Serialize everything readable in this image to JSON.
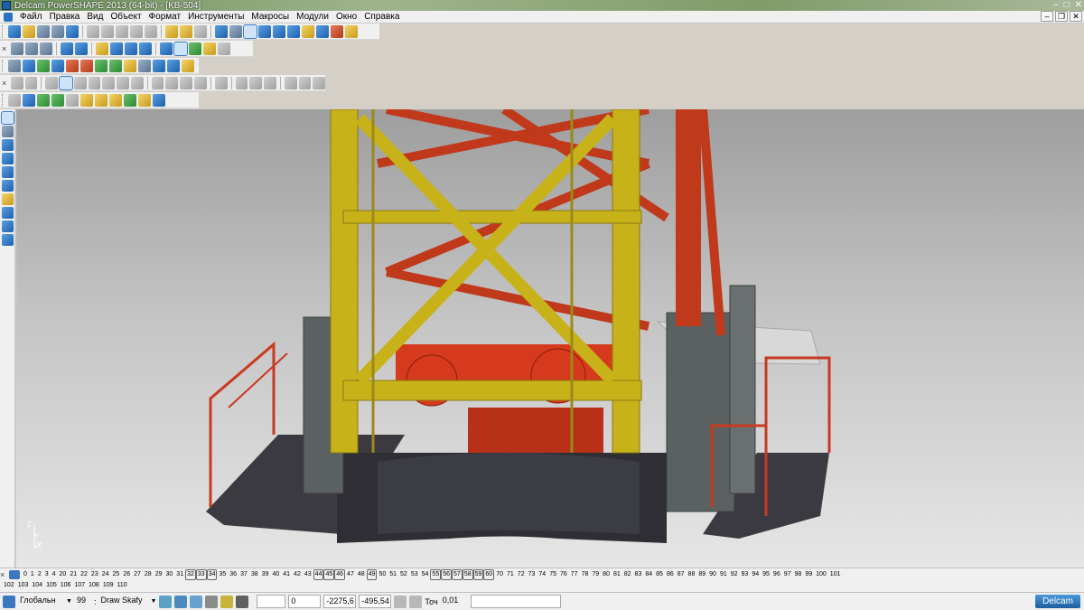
{
  "window": {
    "title": "Delcam PowerSHAPE 2013 (64-bit) - [KB-504]",
    "controls": [
      "–",
      "□",
      "✕"
    ]
  },
  "menu": {
    "items": [
      "Файл",
      "Правка",
      "Вид",
      "Объект",
      "Формат",
      "Инструменты",
      "Макросы",
      "Модули",
      "Окно",
      "Справка"
    ],
    "mdi_controls": [
      "–",
      "❐",
      "✕"
    ]
  },
  "viewport": {
    "axis": {
      "z": "Z",
      "y": "Y",
      "x": "X"
    },
    "colors": {
      "mast": "#c8b21a",
      "boom": "#c0391b",
      "motor": "#d63a1c",
      "platform": "#3a3a40",
      "cabinet": "#5b6060",
      "railing": "#c83a20"
    }
  },
  "levels": {
    "row1": [
      {
        "v": "0"
      },
      {
        "v": "1"
      },
      {
        "v": "2"
      },
      {
        "v": "3"
      },
      {
        "v": "4"
      },
      {
        "v": "20"
      },
      {
        "v": "21"
      },
      {
        "v": "22"
      },
      {
        "v": "23"
      },
      {
        "v": "24"
      },
      {
        "v": "25"
      },
      {
        "v": "26"
      },
      {
        "v": "27"
      },
      {
        "v": "28"
      },
      {
        "v": "29"
      },
      {
        "v": "30"
      },
      {
        "v": "31"
      },
      {
        "v": "32",
        "f": true
      },
      {
        "v": "33",
        "f": true
      },
      {
        "v": "34",
        "f": true
      },
      {
        "v": "35"
      },
      {
        "v": "36"
      },
      {
        "v": "37"
      },
      {
        "v": "38"
      },
      {
        "v": "39"
      },
      {
        "v": "40"
      },
      {
        "v": "41"
      },
      {
        "v": "42"
      },
      {
        "v": "43"
      },
      {
        "v": "44",
        "f": true
      },
      {
        "v": "45",
        "f": true
      },
      {
        "v": "46",
        "f": true
      },
      {
        "v": "47"
      },
      {
        "v": "48"
      },
      {
        "v": "49",
        "f": true
      },
      {
        "v": "50"
      },
      {
        "v": "51"
      },
      {
        "v": "52"
      },
      {
        "v": "53"
      },
      {
        "v": "54"
      },
      {
        "v": "55",
        "f": true
      },
      {
        "v": "56",
        "f": true
      },
      {
        "v": "57",
        "f": true
      },
      {
        "v": "58",
        "f": true
      },
      {
        "v": "59",
        "f": true
      },
      {
        "v": "60",
        "f": true
      },
      {
        "v": "70"
      },
      {
        "v": "71"
      },
      {
        "v": "72"
      },
      {
        "v": "73"
      },
      {
        "v": "74"
      },
      {
        "v": "75"
      },
      {
        "v": "76"
      },
      {
        "v": "77"
      },
      {
        "v": "78"
      },
      {
        "v": "79"
      },
      {
        "v": "80"
      },
      {
        "v": "81"
      },
      {
        "v": "82"
      },
      {
        "v": "83"
      },
      {
        "v": "84"
      },
      {
        "v": "85"
      },
      {
        "v": "86"
      },
      {
        "v": "87"
      },
      {
        "v": "88"
      },
      {
        "v": "89"
      },
      {
        "v": "90"
      },
      {
        "v": "91"
      },
      {
        "v": "92"
      },
      {
        "v": "93"
      },
      {
        "v": "94"
      },
      {
        "v": "95"
      },
      {
        "v": "96"
      },
      {
        "v": "97"
      },
      {
        "v": "98"
      },
      {
        "v": "99"
      },
      {
        "v": "100"
      },
      {
        "v": "101"
      }
    ],
    "row2": [
      "102",
      "103",
      "104",
      "105",
      "106",
      "107",
      "108",
      "109",
      "110"
    ]
  },
  "status": {
    "workplane": "Глобальн",
    "level_num": "99",
    "level_name": "Draw Skafy",
    "field0": "0",
    "x": "-2275,6",
    "y": "-495,54",
    "tolerance_label": "Точ",
    "tolerance": "0,01",
    "brand": "Delcam"
  }
}
